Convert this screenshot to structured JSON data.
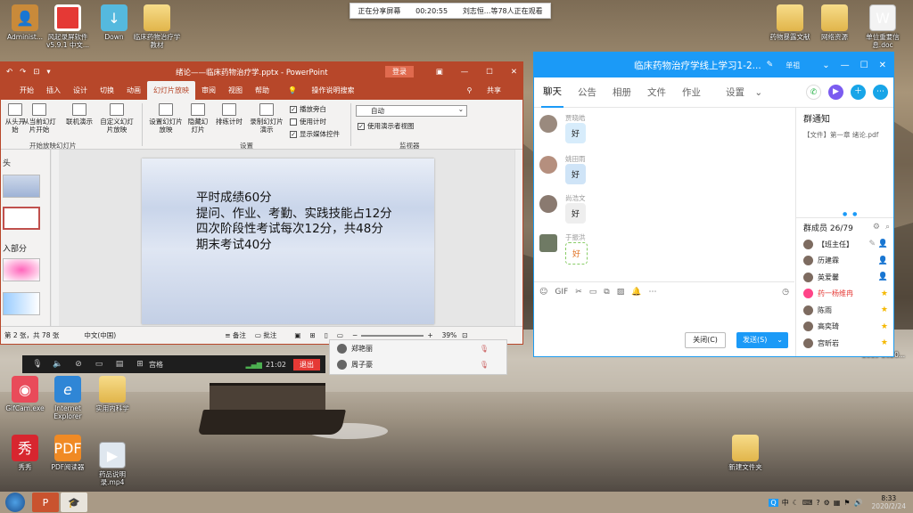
{
  "share_banner": {
    "status": "正在分享屏幕",
    "elapsed": "00:20:55",
    "viewers": "刘志恒...等78人正在观看"
  },
  "desktop": {
    "icons_left": [
      {
        "label": "Administ...",
        "icon": "user-folder-icon"
      },
      {
        "label": "风起录屏软件v5.9.1 中文...",
        "icon": "recorder-icon"
      },
      {
        "label": "Down",
        "icon": "download-app-icon"
      },
      {
        "label": "临床药物治疗学教材",
        "icon": "folder-icon"
      }
    ],
    "icons_right": [
      {
        "label": "药物暴露文献",
        "icon": "folder-icon"
      },
      {
        "label": "网络资源",
        "icon": "folder-icon"
      },
      {
        "label": "单位重要信息.doc",
        "icon": "document-icon"
      }
    ],
    "icons_bottom": [
      {
        "label": "GifCam.exe",
        "icon": "camera-icon"
      },
      {
        "label": "Internet Explorer",
        "icon": "ie-icon"
      },
      {
        "label": "实用内科学",
        "icon": "folder-icon"
      },
      {
        "label": "秀秀",
        "icon": "show-app-icon"
      },
      {
        "label": "PDF阅读器",
        "icon": "pdf-icon"
      },
      {
        "label": "药品说明录.mp4",
        "icon": "video-file-icon"
      }
    ],
    "new_folder": "新建文件夹",
    "date_fragment": "2019-2020..."
  },
  "ppt": {
    "title": "绪论——临床药物治疗学.pptx - PowerPoint",
    "login": "登录",
    "tabs": [
      "开始",
      "插入",
      "设计",
      "切换",
      "动画",
      "幻灯片放映",
      "审阅",
      "视图",
      "帮助"
    ],
    "active_tab": "幻灯片放映",
    "tell_me": "操作说明搜索",
    "share": "共享",
    "ribbon": {
      "from_start": "从头开始",
      "from_current": "从当前幻灯片开始",
      "online": "联机演示",
      "custom": "自定义幻灯片放映",
      "group_start": "开始放映幻灯片",
      "setup": "设置幻灯片放映",
      "hide": "隐藏幻灯片",
      "rehearse": "排练计时",
      "record": "录制幻灯片演示",
      "play_narration": "播放旁白",
      "use_timings": "使用计时",
      "show_media": "显示媒体控件",
      "group_setup": "设置",
      "monitor": "自动",
      "presenter_view": "使用演示者视图",
      "group_monitor": "监视器"
    },
    "thumb_pane": {
      "label_top": "头",
      "label_mid": "入部分"
    },
    "slide_text": [
      "平时成绩60分",
      "提问、作业、考勤、实践技能占12分",
      "四次阶段性考试每次12分，共48分",
      "期末考试40分"
    ],
    "status": {
      "slide_count": "第 2 张，共 78 张",
      "language": "中文(中国)",
      "notes": "备注",
      "comments": "批注",
      "zoom": "39%"
    }
  },
  "meeting": {
    "gallery": "宫格",
    "time": "21:02",
    "leave": "退出",
    "attendees": [
      "郑艳丽",
      "周子豪"
    ]
  },
  "qq": {
    "title": "临床药物治疗学线上学习1-2...",
    "user": "单祖",
    "tabs": [
      "聊天",
      "公告",
      "相册",
      "文件",
      "作业",
      "设置"
    ],
    "active_tab": "聊天",
    "messages": [
      {
        "name": "贾晓皓",
        "text": "好"
      },
      {
        "name": "姚田雨",
        "text": "好"
      },
      {
        "name": "尚浩文",
        "text": "好"
      },
      {
        "name": "于振洪",
        "text": "好"
      }
    ],
    "close_btn": "关闭(C)",
    "send_btn": "发送(S)",
    "notice": {
      "title": "群通知",
      "item": "【文件】第一章 绪论.pdf"
    },
    "members_header": "群成员 26/79",
    "members": [
      {
        "name": "【班主任】",
        "color": "#222"
      },
      {
        "name": "历建霖",
        "color": "#222"
      },
      {
        "name": "英爱馨",
        "color": "#222"
      },
      {
        "name": "药一杨维冉",
        "color": "#e53935"
      },
      {
        "name": "陈雨",
        "color": "#222"
      },
      {
        "name": "高奕琦",
        "color": "#222"
      },
      {
        "name": "宫昕岩",
        "color": "#222"
      }
    ]
  },
  "taskbar": {
    "time": "8:33",
    "date": "2020/2/24",
    "tray_lang": "中"
  }
}
